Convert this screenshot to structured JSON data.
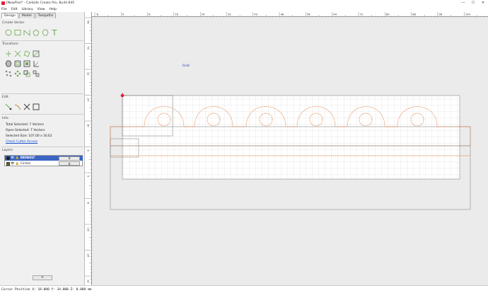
{
  "window": {
    "title": "[NewFile]* - Carbide Create Pro, Build 845",
    "minimize_glyph": "—",
    "maximize_glyph": "☐",
    "close_glyph": "✕"
  },
  "menu": [
    "File",
    "Edit",
    "Library",
    "View",
    "Help"
  ],
  "tabs": [
    {
      "label": "Design",
      "active": true
    },
    {
      "label": "Model",
      "active": false
    },
    {
      "label": "Toolpaths",
      "active": false
    }
  ],
  "sections": {
    "create_vector": "Create Vector",
    "transform": "Transform",
    "edit": "Edit",
    "info": "Info",
    "layers": "Layers"
  },
  "create_vector_icons": [
    "circle-icon",
    "rectangle-icon",
    "curve-icon",
    "polygon-icon",
    "star-icon",
    "text-icon"
  ],
  "info": {
    "total_selected": "Total Selected:  7 Vectors",
    "open_selected": "Open Selected:  7 Vectors",
    "selected_size": "Selected Size:  107.00 x 16.62",
    "check_cutter": "Check Cutter Access"
  },
  "layers": [
    {
      "name": "DEFAULT",
      "color": "#1a1a1a",
      "selected": true
    },
    {
      "name": "Circles",
      "color": "#7a6a1a",
      "selected": false
    }
  ],
  "layer_button_glyph": "⚙",
  "add_layer_label": "+",
  "canvas": {
    "grid_label": "Grid",
    "accent": "#e07a3c",
    "ruler_labels_h": [
      "-8",
      "0",
      "8",
      "16",
      "24",
      "32",
      "40",
      "48",
      "56",
      "64",
      "72",
      "80",
      "88",
      "96",
      "104"
    ],
    "ruler_labels_v": [
      "48",
      "40",
      "32",
      "24",
      "16",
      "8",
      "0",
      "-8",
      "-16",
      "-24",
      "-32"
    ]
  },
  "status": {
    "cursor": "Cursor Position X: 18.000 Y: 34.000 Z: 0.000 mm"
  }
}
